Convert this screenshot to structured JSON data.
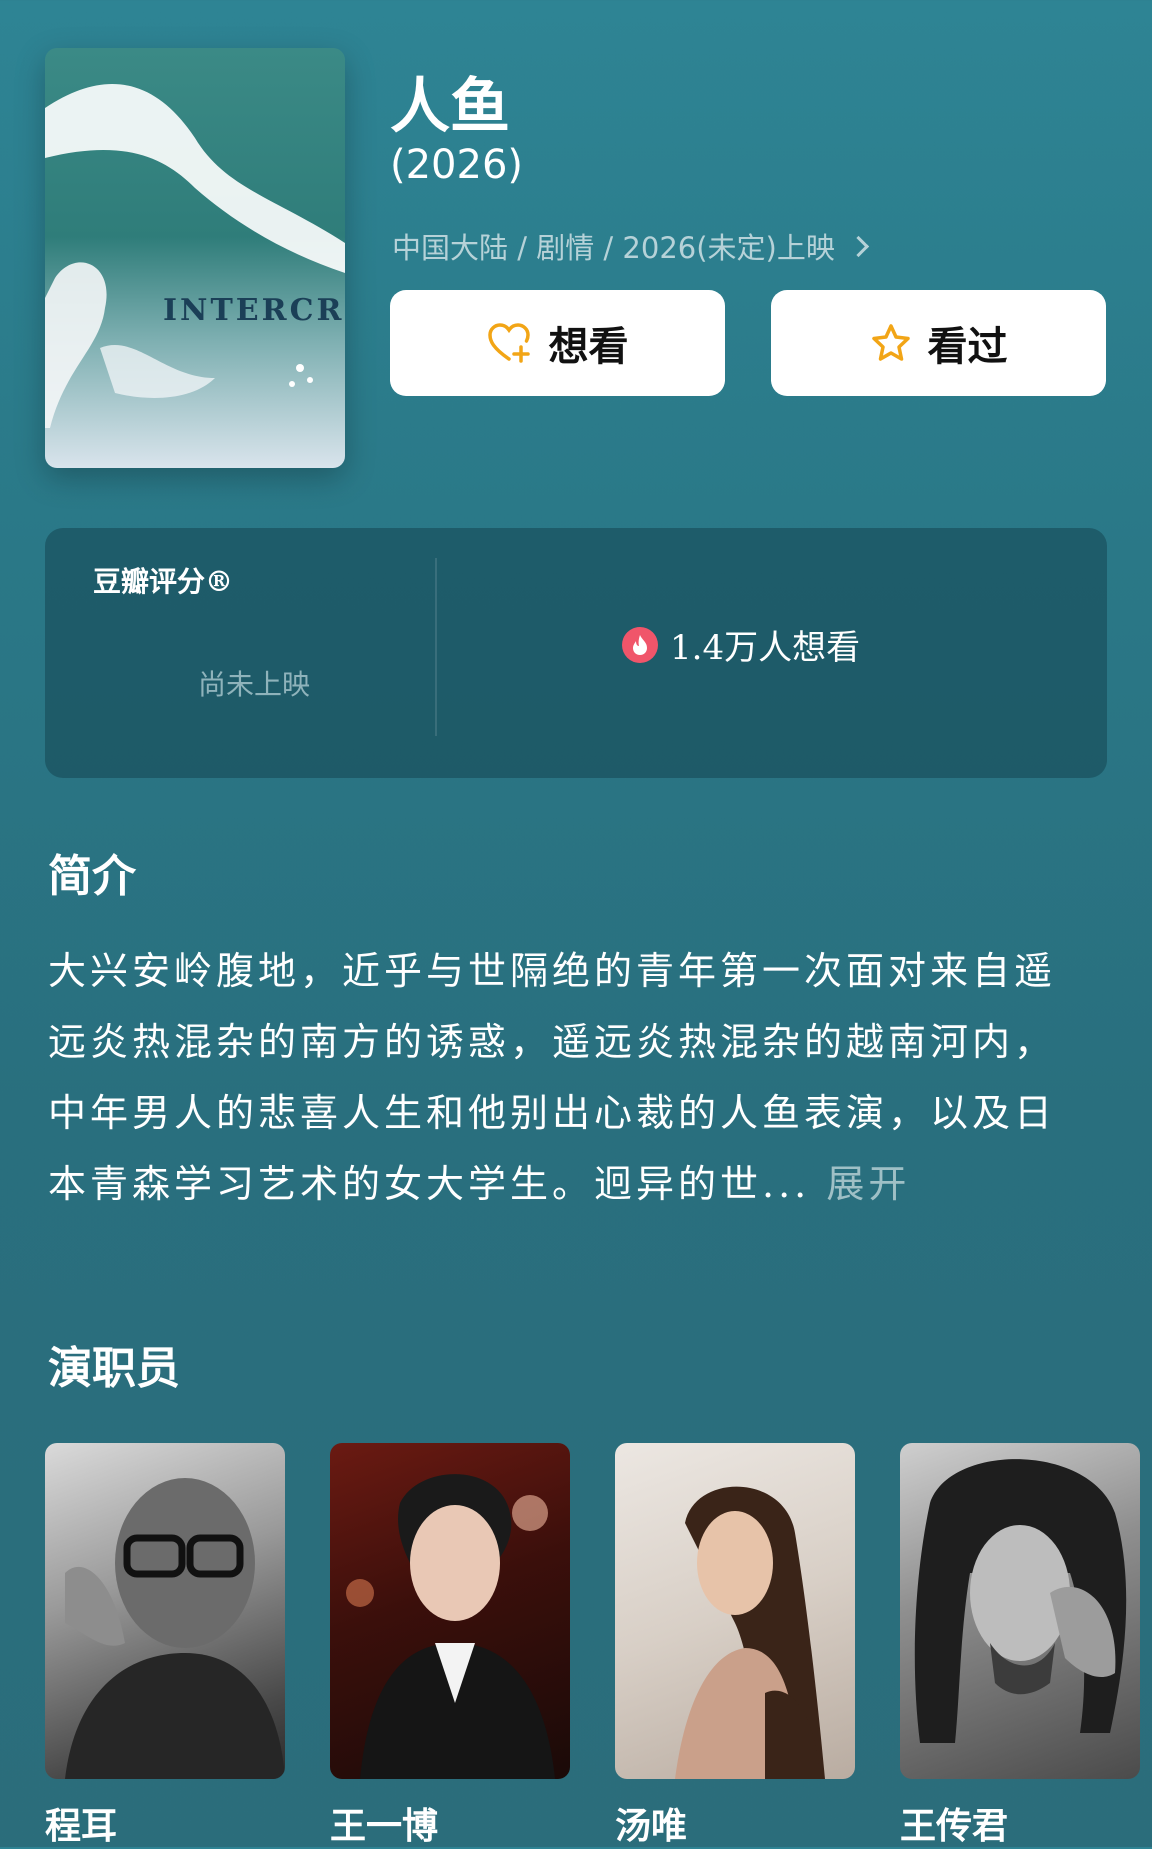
{
  "movie": {
    "title": "人鱼",
    "year": "(2026)",
    "meta": "中国大陆 / 剧情 / 2026(未定)上映",
    "poster_text": "INTERCR"
  },
  "actions": {
    "want_label": "想看",
    "seen_label": "看过"
  },
  "rating": {
    "label": "豆瓣评分®",
    "status": "尚未上映",
    "want_count": "1.4万人想看"
  },
  "summary": {
    "heading": "简介",
    "text": "大兴安岭腹地，近乎与世隔绝的青年第一次面对来自遥远炎热混杂的南方的诱惑，遥远炎热混杂的越南河内，中年男人的悲喜人生和他别出心裁的人鱼表演，以及日本青森学习艺术的女大学生。迥异的世...",
    "expand": "展开"
  },
  "cast": {
    "heading": "演职员",
    "members": [
      {
        "name": "程耳"
      },
      {
        "name": "王一博"
      },
      {
        "name": "汤唯"
      },
      {
        "name": "王传君"
      }
    ]
  },
  "colors": {
    "background": "#2b7887",
    "accent_icon": "#f2a516",
    "fire": "#f0556a"
  }
}
